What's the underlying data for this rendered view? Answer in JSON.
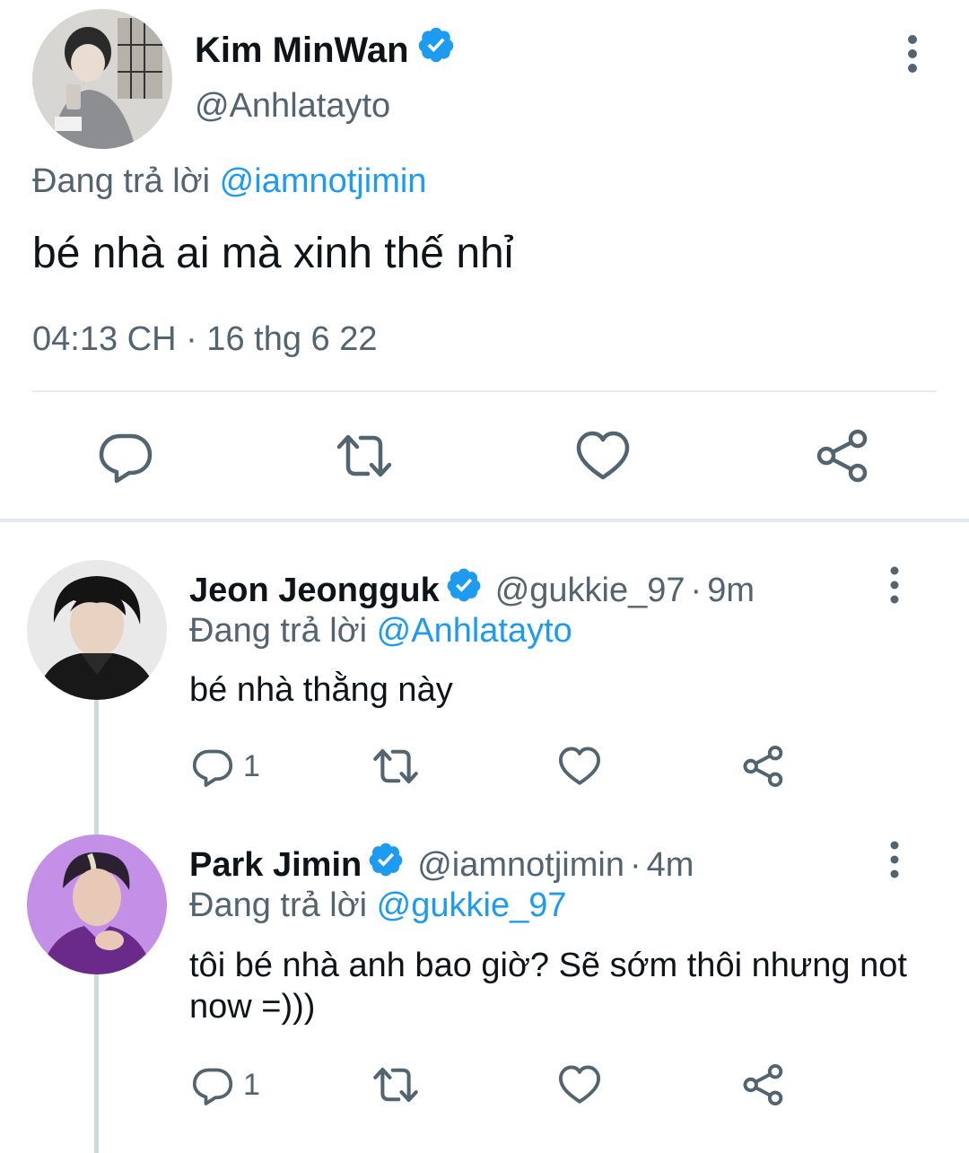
{
  "main_tweet": {
    "display_name": "Kim MinWan",
    "handle": "@Anhlatayto",
    "replying_prefix": "Đang trả lời",
    "replying_to": "@iamnotjimin",
    "text": "bé nhà ai mà xinh thế nhỉ",
    "timestamp": "04:13 CH · 16 thg 6 22",
    "verified": true,
    "more_icon": "more-vertical-icon",
    "actions": [
      {
        "icon": "reply-icon"
      },
      {
        "icon": "retweet-icon"
      },
      {
        "icon": "like-icon"
      },
      {
        "icon": "share-icon"
      }
    ]
  },
  "replies": [
    {
      "display_name": "Jeon Jeongguk",
      "handle": "@gukkie_97",
      "separator": "·",
      "time": "9m",
      "replying_prefix": "Đang trả lời",
      "replying_to": "@Anhlatayto",
      "text": "bé nhà thằng này",
      "reply_count": "1",
      "verified": true
    },
    {
      "display_name": "Park Jimin",
      "handle": "@iamnotjimin",
      "separator": "·",
      "time": "4m",
      "replying_prefix": "Đang trả lời",
      "replying_to": "@gukkie_97",
      "text": "tôi bé nhà anh bao giờ? Sẽ sớm thôi nhưng not now =)))",
      "reply_count": "1",
      "verified": true
    }
  ],
  "colors": {
    "accent": "#1d9bf0",
    "text_primary": "#0f1419",
    "text_secondary": "#536471",
    "divider": "#e6eaed",
    "thread_line": "#cfd9de"
  }
}
